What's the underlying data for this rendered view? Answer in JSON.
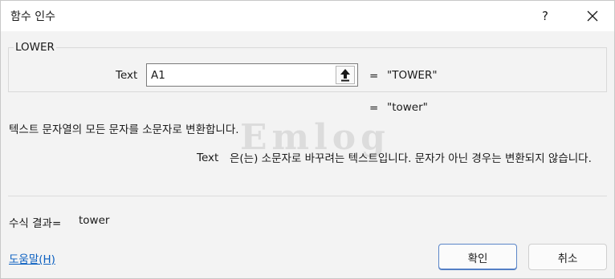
{
  "dialog": {
    "title": "함수 인수",
    "help_glyph": "?",
    "function_name": "LOWER"
  },
  "argument": {
    "label": "Text",
    "value": "A1",
    "equals": "=",
    "evaluated": "\"TOWER\""
  },
  "function_result": {
    "equals": "=",
    "value": "\"tower\""
  },
  "description": "텍스트 문자열의 모든 문자를 소문자로 변환합니다.",
  "argument_help": {
    "label": "Text",
    "text": "은(는) 소문자로 바꾸려는 텍스트입니다. 문자가 아닌 경우는 변환되지 않습니다."
  },
  "formula_result": {
    "label": "수식 결과=",
    "value": "tower"
  },
  "help_link": "도움말(H)",
  "buttons": {
    "ok": "확인",
    "cancel": "취소"
  },
  "watermark": "Emlog"
}
